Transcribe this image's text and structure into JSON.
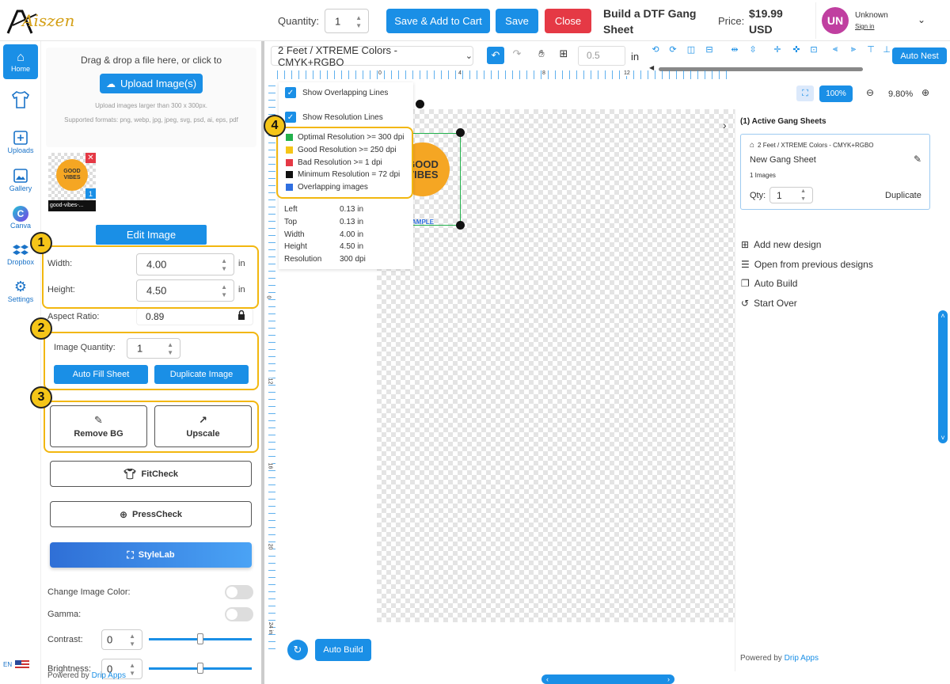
{
  "header": {
    "logo": "Aiszen",
    "quantity_label": "Quantity:",
    "quantity_value": "1",
    "save_add_cart": "Save & Add to Cart",
    "save": "Save",
    "close": "Close",
    "title": "Build a DTF Gang Sheet",
    "price_label": "Price:",
    "price_value": "$19.99 USD",
    "user_initials": "UN",
    "user_name": "Unknown",
    "sign_in": "Sign in"
  },
  "sidebar": {
    "items": [
      {
        "label": "Home",
        "icon": "home-icon"
      },
      {
        "label": "",
        "icon": "tshirt-icon"
      },
      {
        "label": "Uploads",
        "icon": "upload-icon"
      },
      {
        "label": "Gallery",
        "icon": "gallery-icon"
      },
      {
        "label": "Canva",
        "icon": "canva-icon"
      },
      {
        "label": "Dropbox",
        "icon": "dropbox-icon"
      },
      {
        "label": "Settings",
        "icon": "gear-icon"
      }
    ],
    "lang": "EN"
  },
  "panel": {
    "drop_text": "Drag & drop a file here, or click to",
    "upload_btn": "Upload Image(s)",
    "upload_hint1": "Upload images larger than 300 x 300px.",
    "upload_hint2": "Supported formats: png, webp, jpg, jpeg, svg, psd, ai, eps, pdf",
    "thumb_badge": "1",
    "thumb_name": "good-vibes-...",
    "thumb_art_text": "GOOD VIBES",
    "edit_image": "Edit Image",
    "width_label": "Width:",
    "width_value": "4.00",
    "height_label": "Height:",
    "height_value": "4.50",
    "unit": "in",
    "aspect_label": "Aspect Ratio:",
    "aspect_value": "0.89",
    "img_qty_label": "Image Quantity:",
    "img_qty_value": "1",
    "auto_fill": "Auto Fill Sheet",
    "duplicate_image": "Duplicate Image",
    "remove_bg": "Remove BG",
    "upscale": "Upscale",
    "fitcheck": "FitCheck",
    "presscheck": "PressCheck",
    "stylelab": "StyleLab",
    "change_color": "Change Image Color:",
    "gamma": "Gamma:",
    "contrast_label": "Contrast:",
    "contrast_value": "0",
    "brightness_label": "Brightness:",
    "brightness_value": "0",
    "powered": "Powered by",
    "drip_apps": "Drip Apps"
  },
  "toolbar": {
    "sheet_select": "2 Feet / XTREME Colors - CMYK+RGBO",
    "grid_value": "0.5",
    "grid_unit": "in",
    "auto_nest": "Auto Nest",
    "zoom_pct_btn": "100%",
    "zoom_value": "9.80%"
  },
  "ruler": {
    "top_ticks": [
      "0",
      "4",
      "8",
      "12"
    ],
    "left_ticks": [
      "0",
      "4",
      "8",
      "12",
      "16",
      "20",
      "24 in"
    ]
  },
  "overlay": {
    "show_overlap": "Show Overlapping Lines",
    "show_resolution": "Show Resolution Lines",
    "legend": [
      {
        "label": "Optimal Resolution >= 300 dpi",
        "color": "#22b14c"
      },
      {
        "label": "Good Resolution >= 250 dpi",
        "color": "#f5c518"
      },
      {
        "label": "Bad Resolution >= 1 dpi",
        "color": "#e53945"
      },
      {
        "label": "Minimum Resolution = 72 dpi",
        "color": "#111111"
      },
      {
        "label": "Overlapping images",
        "color": "#2f6fe0"
      }
    ],
    "info": [
      {
        "k": "Left",
        "v": "0.13 in"
      },
      {
        "k": "Top",
        "v": "0.13 in"
      },
      {
        "k": "Width",
        "v": "4.00 in"
      },
      {
        "k": "Height",
        "v": "4.50 in"
      },
      {
        "k": "Resolution",
        "v": "300 dpi"
      }
    ],
    "canvas_art_text": "GOOD VIBES",
    "canvas_art_sub": "AMPLE"
  },
  "canvas": {
    "auto_build": "Auto Build"
  },
  "right": {
    "header": "(1)  Active Gang Sheets",
    "card_path": "2 Feet / XTREME Colors - CMYK+RGBO",
    "card_title": "New Gang Sheet",
    "card_count": "1 Images",
    "qty_label": "Qty:",
    "qty_value": "1",
    "duplicate": "Duplicate",
    "add_new": "Add new design",
    "open_prev": "Open from previous designs",
    "auto_build": "Auto Build",
    "start_over": "Start Over",
    "powered": "Powered by",
    "drip_apps": "Drip Apps"
  },
  "callouts": [
    "1",
    "2",
    "3",
    "4"
  ],
  "colors": {
    "accent": "#1a8fe6",
    "danger": "#e53945",
    "callout": "#f2b70f"
  }
}
